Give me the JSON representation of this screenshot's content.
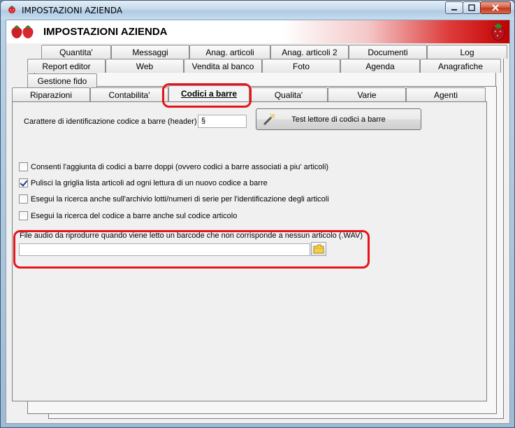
{
  "window": {
    "title": "IMPOSTAZIONI AZIENDA",
    "controls": {
      "minimize": "minimize",
      "maximize": "maximize",
      "close": "close"
    }
  },
  "banner": {
    "title": "IMPOSTAZIONI AZIENDA"
  },
  "tabs": {
    "row1": [
      "Quantita'",
      "Messaggi",
      "Anag. articoli",
      "Anag. articoli 2",
      "Documenti",
      "Log"
    ],
    "row2": [
      "Report editor",
      "Web",
      "Vendita al banco",
      "Foto",
      "Agenda",
      "Anagrafiche"
    ],
    "row3": [
      "Gestione fido"
    ],
    "row4": [
      "Riparazioni",
      "Contabilita'",
      "Codici a barre",
      "Qualita'",
      "Varie",
      "Agenti"
    ],
    "active": "Codici a barre"
  },
  "barcode": {
    "header_label": "Carattere di identificazione codice a barre (header) :",
    "header_value": "§",
    "test_button": "Test lettore di codici a barre"
  },
  "options": [
    {
      "label": "Consenti l'aggiunta di codici a barre doppi (ovvero codici a barre associati a piu' articoli)",
      "checked": false
    },
    {
      "label": "Pulisci la griglia lista articoli ad ogni lettura di un nuovo codice a barre",
      "checked": true
    },
    {
      "label": "Esegui la ricerca anche sull'archivio lotti/numeri di serie per l'identificazione degli articoli",
      "checked": false
    },
    {
      "label": "Esegui la ricerca del codice a barre anche sul codice articolo",
      "checked": false
    }
  ],
  "audio": {
    "label": "File audio da riprodurre quando viene letto un barcode che non corrisponde a nessun articolo (.WAV)",
    "value": ""
  },
  "colors": {
    "highlight": "#e8131a",
    "banner_red": "#c00000"
  }
}
